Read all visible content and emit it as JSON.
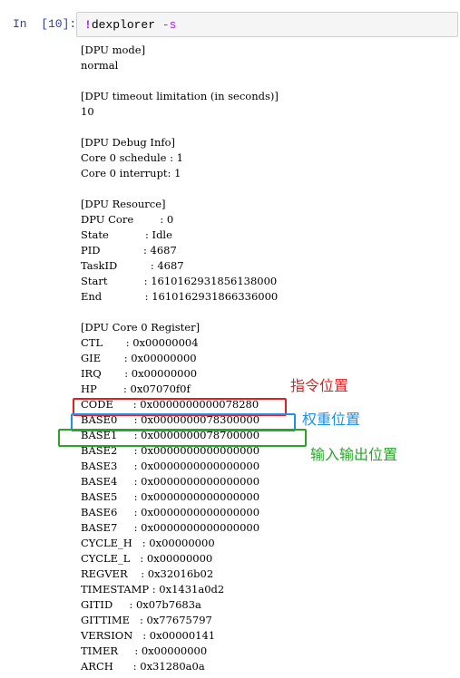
{
  "cell": {
    "prompt": "In  [10]:",
    "command_bang": "!",
    "command_name": "dexplorer ",
    "command_flag": "-s"
  },
  "output_lines": [
    "[DPU mode]",
    "normal",
    "",
    "[DPU timeout limitation (in seconds)]",
    "10",
    "",
    "[DPU Debug Info]",
    "Core 0 schedule : 1",
    "Core 0 interrupt: 1",
    "",
    "[DPU Resource]",
    "DPU Core        : 0",
    "State           : Idle",
    "PID             : 4687",
    "TaskID          : 4687",
    "Start           : 1610162931856138000",
    "End             : 1610162931866336000",
    "",
    "[DPU Core 0 Register]",
    "CTL       : 0x00000004",
    "GIE       : 0x00000000",
    "IRQ       : 0x00000000",
    "HP        : 0x07070f0f",
    "CODE      : 0x0000000000078280",
    "BASE0     : 0x0000000078300000",
    "BASE1     : 0x0000000078700000",
    "BASE2     : 0x0000000000000000",
    "BASE3     : 0x0000000000000000",
    "BASE4     : 0x0000000000000000",
    "BASE5     : 0x0000000000000000",
    "BASE6     : 0x0000000000000000",
    "BASE7     : 0x0000000000000000",
    "CYCLE_H   : 0x00000000",
    "CYCLE_L   : 0x00000000",
    "REGVER    : 0x32016b02",
    "TIMESTAMP : 0x1431a0d2",
    "GITID     : 0x07b7683a",
    "GITTIME   : 0x77675797",
    "VERSION   : 0x00000141",
    "TIMER     : 0x00000000",
    "ARCH      : 0x31280a0a"
  ],
  "annotations": {
    "code": {
      "label": "指令位置",
      "color": "#e02020"
    },
    "base0": {
      "label": "权重位置",
      "color": "#1e90e8"
    },
    "base1": {
      "label": "输入输出位置",
      "color": "#2aa52a"
    }
  }
}
